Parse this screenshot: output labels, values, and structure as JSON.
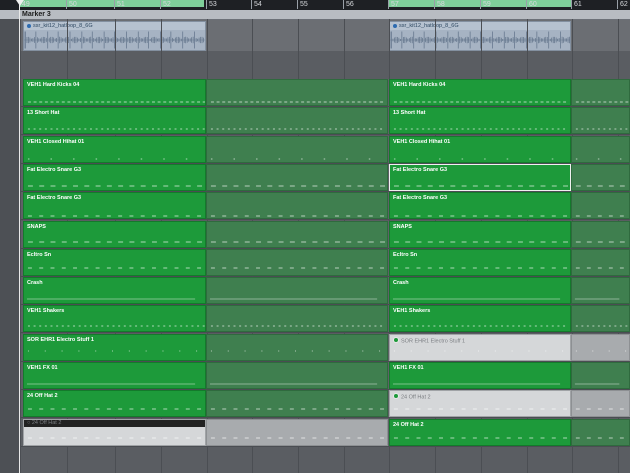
{
  "ruler": {
    "bars": [
      "49",
      "50",
      "51",
      "52",
      "53",
      "54",
      "55",
      "56",
      "57",
      "58",
      "59",
      "60",
      "61",
      "62"
    ]
  },
  "marker": {
    "label": "Marker 3"
  },
  "audio_regions": [
    {
      "name": "ssr_kit12_hatloop_8_6G"
    },
    {
      "name": "ssr_kit12_hatloop_8_6G"
    }
  ],
  "tracks": [
    {
      "left": "VEH1 Hard Kicks 04",
      "right": "VEH1 Hard Kicks 04",
      "right_style": "green"
    },
    {
      "left": "13 Short Hat",
      "right": "13 Short Hat",
      "right_style": "green"
    },
    {
      "left": "VEH1 Closed Hihat 01",
      "right": "VEH1 Closed Hihat 01",
      "right_style": "green"
    },
    {
      "left": "Fat Electro Snare G3",
      "right": "Fat Electro Snare G3",
      "right_style": "green-selected"
    },
    {
      "left": "Fat Electro Snare G3",
      "right": "Fat Electro Snare G3",
      "right_style": "green"
    },
    {
      "left": "SNAPS",
      "right": "SNAPS",
      "right_style": "green"
    },
    {
      "left": "Ecltro Sn",
      "right": "Ecltro Sn",
      "right_style": "green"
    },
    {
      "left": "Crash",
      "right": "Crash",
      "right_style": "green"
    },
    {
      "left": "VEH1 Shakers",
      "right": "VEH1 Shakers",
      "right_style": "green"
    },
    {
      "left": "SOR EHR1 Electro Stuff 1",
      "right": "SOR EHR1 Electro Stuff 1",
      "right_style": "white"
    },
    {
      "left": "VEH1 FX 01",
      "right": "VEH1 FX 01",
      "right_style": "green"
    },
    {
      "left": "24 Off Hat 2",
      "right": "24 Off Hat 2",
      "right_style": "white"
    },
    {
      "left": "24 Off Hat 2",
      "right": "24 Off Hat 2",
      "right_style": "green",
      "left_style": "white"
    }
  ],
  "colors": {
    "region_green": "#1d9a3a",
    "region_white": "#d5d7d9",
    "cycle": "#7fcf9a",
    "audio_region": "#a6b3c3"
  }
}
